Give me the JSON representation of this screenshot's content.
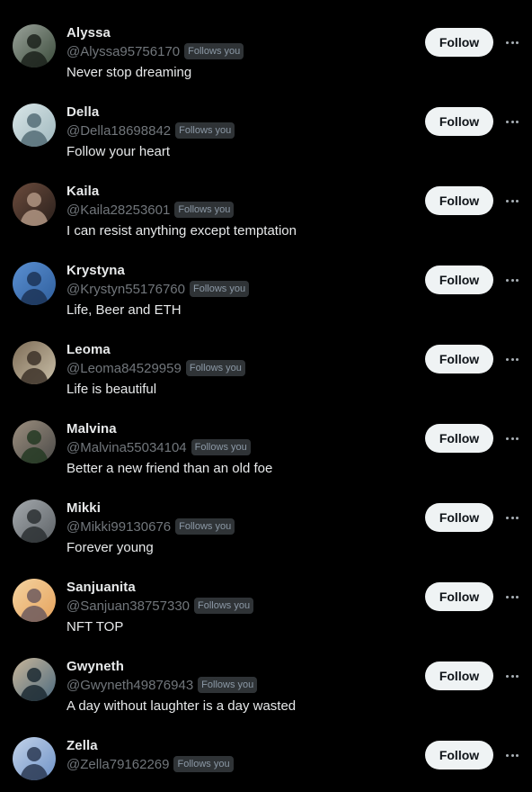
{
  "users": [
    {
      "name": "Alyssa",
      "handle": "@Alyssa95756170",
      "badge": "Follows you",
      "bio": "Never stop dreaming",
      "follow_label": "Follow",
      "avatar_icon": "user-photo-avatar",
      "colors": [
        "#3a4a3a",
        "#9aa29a",
        "#1c221c"
      ]
    },
    {
      "name": "Della",
      "handle": "@Della18698842",
      "badge": "Follows you",
      "bio": "Follow your heart",
      "follow_label": "Follow",
      "avatar_icon": "user-photo-avatar",
      "colors": [
        "#9fb7bd",
        "#d9e6e8",
        "#556d77"
      ]
    },
    {
      "name": "Kaila",
      "handle": "@Kaila28253601",
      "badge": "Follows you",
      "bio": "I can resist anything except temptation",
      "follow_label": "Follow",
      "avatar_icon": "user-photo-avatar",
      "colors": [
        "#2a201c",
        "#6b4b3c",
        "#b09583"
      ]
    },
    {
      "name": "Krystyna",
      "handle": "@Krystyn55176760",
      "badge": "Follows you",
      "bio": "Life, Beer and ETH",
      "follow_label": "Follow",
      "avatar_icon": "user-photo-avatar",
      "colors": [
        "#2f5f9d",
        "#5a8fd1",
        "#1c3457"
      ]
    },
    {
      "name": "Leoma",
      "handle": "@Leoma84529959",
      "badge": "Follows you",
      "bio": "Life is beautiful",
      "follow_label": "Follow",
      "avatar_icon": "user-photo-avatar",
      "colors": [
        "#c9bfa8",
        "#7e6d57",
        "#3d3229"
      ]
    },
    {
      "name": "Malvina",
      "handle": "@Malvina55034104",
      "badge": "Follows you",
      "bio": "Better a new friend than an old foe",
      "follow_label": "Follow",
      "avatar_icon": "user-photo-avatar",
      "colors": [
        "#4b4a48",
        "#9b8e7e",
        "#253a23"
      ]
    },
    {
      "name": "Mikki",
      "handle": "@Mikki99130676",
      "badge": "Follows you",
      "bio": "Forever young",
      "follow_label": "Follow",
      "avatar_icon": "user-photo-avatar",
      "colors": [
        "#5d6266",
        "#a4a9ad",
        "#2c3033"
      ]
    },
    {
      "name": "Sanjuanita",
      "handle": "@Sanjuan38757330",
      "badge": "Follows you",
      "bio": "NFT TOP",
      "follow_label": "Follow",
      "avatar_icon": "user-photo-avatar",
      "colors": [
        "#e6a35d",
        "#f4d3a0",
        "#6d5a5e"
      ]
    },
    {
      "name": "Gwyneth",
      "handle": "@Gwyneth49876943",
      "badge": "Follows you",
      "bio": "A day without laughter is a day wasted",
      "follow_label": "Follow",
      "avatar_icon": "user-photo-avatar",
      "colors": [
        "#4c6a7f",
        "#c8b69a",
        "#1c2a33"
      ]
    },
    {
      "name": "Zella",
      "handle": "@Zella79162269",
      "badge": "Follows you",
      "bio": "",
      "follow_label": "Follow",
      "avatar_icon": "user-photo-avatar",
      "colors": [
        "#6f93c8",
        "#c2d2e8",
        "#2b3a54"
      ]
    }
  ],
  "more_icon": "more-horizontal-icon",
  "colors": {
    "background": "#000000",
    "text_primary": "#e7e9ea",
    "text_secondary": "#71767b",
    "badge_bg": "#2f3336",
    "button_bg": "#eff3f4",
    "button_text": "#0f1419"
  }
}
